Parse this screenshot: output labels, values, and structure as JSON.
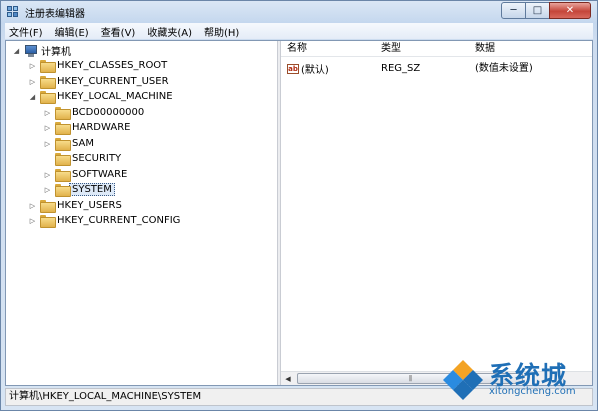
{
  "window": {
    "title": "注册表编辑器"
  },
  "menu": [
    "文件(F)",
    "编辑(E)",
    "查看(V)",
    "收藏夹(A)",
    "帮助(H)"
  ],
  "tree": {
    "root": "计算机",
    "hives": [
      {
        "label": "HKEY_CLASSES_ROOT"
      },
      {
        "label": "HKEY_CURRENT_USER"
      },
      {
        "label": "HKEY_LOCAL_MACHINE",
        "children": [
          "BCD00000000",
          "HARDWARE",
          "SAM",
          "SECURITY",
          "SOFTWARE",
          "SYSTEM"
        ]
      },
      {
        "label": "HKEY_USERS"
      },
      {
        "label": "HKEY_CURRENT_CONFIG"
      }
    ],
    "selected": "SYSTEM"
  },
  "list": {
    "columns": [
      "名称",
      "类型",
      "数据"
    ],
    "rows": [
      {
        "name": "(默认)",
        "type": "REG_SZ",
        "data": "(数值未设置)",
        "icon": "ab-string-icon"
      }
    ]
  },
  "status": {
    "path": "计算机\\HKEY_LOCAL_MACHINE\\SYSTEM"
  },
  "watermark": {
    "brand": "系统城",
    "url": "xitongcheng.com"
  },
  "colors": {
    "accent": "#1f6fb6",
    "folder": "#e8c15a",
    "close": "#c5463a"
  }
}
